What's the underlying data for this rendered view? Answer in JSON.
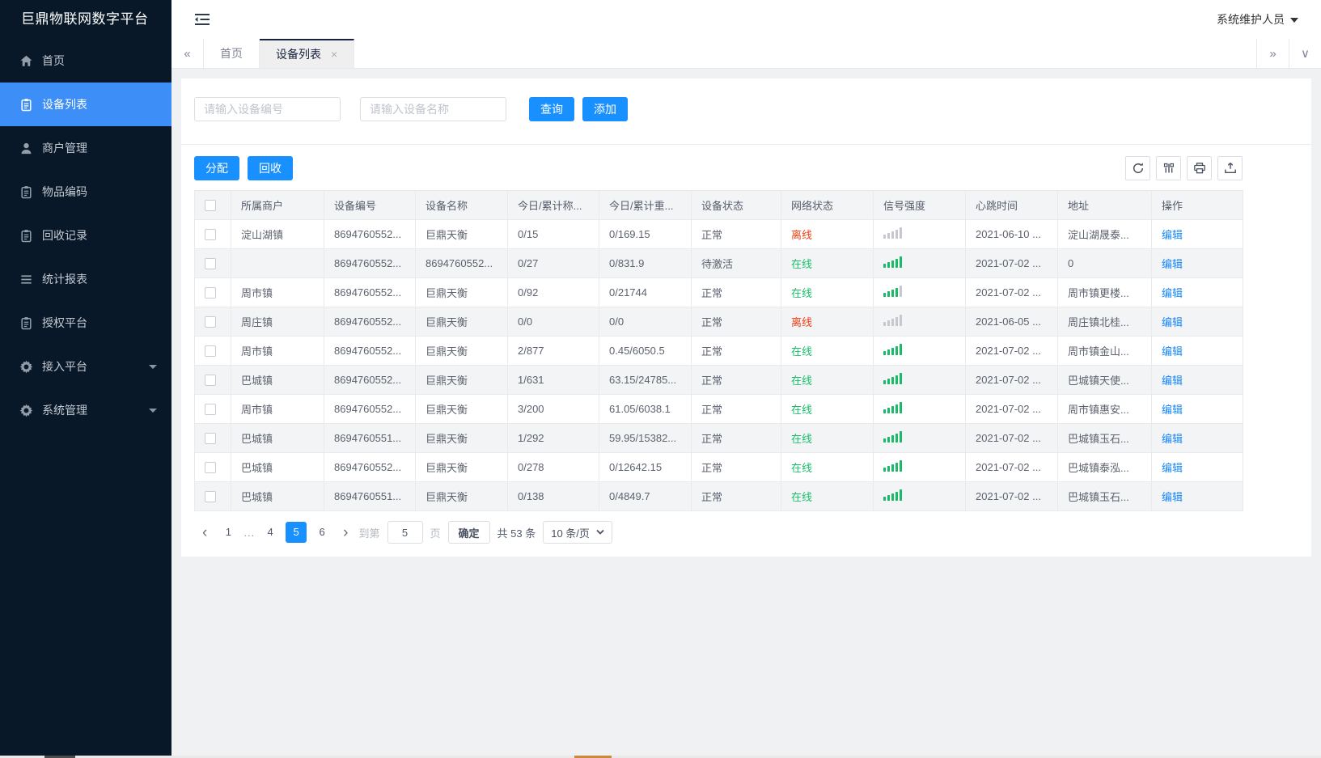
{
  "app": {
    "title": "巨鼎物联网数字平台",
    "user_role": "系统维护人员"
  },
  "sidebar": {
    "items": [
      {
        "id": "home",
        "icon": "home",
        "label": "首页"
      },
      {
        "id": "device-list",
        "icon": "clipboard",
        "label": "设备列表",
        "active": true
      },
      {
        "id": "merchant-management",
        "icon": "user",
        "label": "商户管理"
      },
      {
        "id": "item-code",
        "icon": "clipboard",
        "label": "物品编码"
      },
      {
        "id": "recycle-record",
        "icon": "clipboard",
        "label": "回收记录"
      },
      {
        "id": "statistics-report",
        "icon": "list",
        "label": "统计报表"
      },
      {
        "id": "authorized-platform",
        "icon": "clipboard",
        "label": "授权平台"
      },
      {
        "id": "access-platform",
        "icon": "gear",
        "label": "接入平台",
        "caret": true
      },
      {
        "id": "system-management",
        "icon": "gear",
        "label": "系统管理",
        "caret": true
      }
    ]
  },
  "tabs": {
    "items": [
      {
        "label": "首页"
      },
      {
        "label": "设备列表",
        "active": true,
        "closable": true
      }
    ]
  },
  "search": {
    "device_no_placeholder": "请输入设备编号",
    "device_name_placeholder": "请输入设备名称",
    "query_label": "查询",
    "add_label": "添加"
  },
  "toolbar": {
    "assign_label": "分配",
    "recycle_label": "回收",
    "icons": [
      "refresh-icon",
      "columns-icon",
      "print-icon",
      "export-icon"
    ]
  },
  "table": {
    "headers": [
      "所属商户",
      "设备编号",
      "设备名称",
      "今日/累计称...",
      "今日/累计重...",
      "设备状态",
      "网络状态",
      "信号强度",
      "心跳时间",
      "地址",
      "操作"
    ],
    "rows": [
      {
        "merchant": "淀山湖镇",
        "device_no": "8694760552...",
        "device_name": "巨鼎天衡",
        "today_total_count": "0/15",
        "today_total_weight": "0/169.15",
        "device_status": "正常",
        "network_status": "离线",
        "online": false,
        "signal": 0,
        "heartbeat": "2021-06-10 ...",
        "address": "淀山湖晟泰...",
        "action": "编辑"
      },
      {
        "merchant": "",
        "device_no": "8694760552...",
        "device_name": "8694760552...",
        "today_total_count": "0/27",
        "today_total_weight": "0/831.9",
        "device_status": "待激活",
        "network_status": "在线",
        "online": true,
        "signal": 5,
        "heartbeat": "2021-07-02 ...",
        "address": "0",
        "action": "编辑"
      },
      {
        "merchant": "周市镇",
        "device_no": "8694760552...",
        "device_name": "巨鼎天衡",
        "today_total_count": "0/92",
        "today_total_weight": "0/21744",
        "device_status": "正常",
        "network_status": "在线",
        "online": true,
        "signal": 4,
        "heartbeat": "2021-07-02 ...",
        "address": "周市镇更楼...",
        "action": "编辑"
      },
      {
        "merchant": "周庄镇",
        "device_no": "8694760552...",
        "device_name": "巨鼎天衡",
        "today_total_count": "0/0",
        "today_total_weight": "0/0",
        "device_status": "正常",
        "network_status": "离线",
        "online": false,
        "signal": 0,
        "heartbeat": "2021-06-05 ...",
        "address": "周庄镇北桂...",
        "action": "编辑"
      },
      {
        "merchant": "周市镇",
        "device_no": "8694760552...",
        "device_name": "巨鼎天衡",
        "today_total_count": "2/877",
        "today_total_weight": "0.45/6050.5",
        "device_status": "正常",
        "network_status": "在线",
        "online": true,
        "signal": 5,
        "heartbeat": "2021-07-02 ...",
        "address": "周市镇金山...",
        "action": "编辑"
      },
      {
        "merchant": "巴城镇",
        "device_no": "8694760552...",
        "device_name": "巨鼎天衡",
        "today_total_count": "1/631",
        "today_total_weight": "63.15/24785...",
        "device_status": "正常",
        "network_status": "在线",
        "online": true,
        "signal": 5,
        "heartbeat": "2021-07-02 ...",
        "address": "巴城镇天使...",
        "action": "编辑"
      },
      {
        "merchant": "周市镇",
        "device_no": "8694760552...",
        "device_name": "巨鼎天衡",
        "today_total_count": "3/200",
        "today_total_weight": "61.05/6038.1",
        "device_status": "正常",
        "network_status": "在线",
        "online": true,
        "signal": 5,
        "heartbeat": "2021-07-02 ...",
        "address": "周市镇惠安...",
        "action": "编辑"
      },
      {
        "merchant": "巴城镇",
        "device_no": "8694760551...",
        "device_name": "巨鼎天衡",
        "today_total_count": "1/292",
        "today_total_weight": "59.95/15382...",
        "device_status": "正常",
        "network_status": "在线",
        "online": true,
        "signal": 5,
        "heartbeat": "2021-07-02 ...",
        "address": "巴城镇玉石...",
        "action": "编辑"
      },
      {
        "merchant": "巴城镇",
        "device_no": "8694760552...",
        "device_name": "巨鼎天衡",
        "today_total_count": "0/278",
        "today_total_weight": "0/12642.15",
        "device_status": "正常",
        "network_status": "在线",
        "online": true,
        "signal": 5,
        "heartbeat": "2021-07-02 ...",
        "address": "巴城镇泰泓...",
        "action": "编辑"
      },
      {
        "merchant": "巴城镇",
        "device_no": "8694760551...",
        "device_name": "巨鼎天衡",
        "today_total_count": "0/138",
        "today_total_weight": "0/4849.7",
        "device_status": "正常",
        "network_status": "在线",
        "online": true,
        "signal": 5,
        "heartbeat": "2021-07-02 ...",
        "address": "巴城镇玉石...",
        "action": "编辑"
      }
    ]
  },
  "pagination": {
    "pages": [
      {
        "label": "1"
      },
      {
        "label": "...",
        "ellipsis": true
      },
      {
        "label": "4"
      },
      {
        "label": "5",
        "active": true
      },
      {
        "label": "6"
      }
    ],
    "goto_label": "到第",
    "goto_value": "5",
    "page_unit": "页",
    "confirm_label": "确定",
    "total_label": "共 53 条",
    "page_size": "10 条/页"
  }
}
